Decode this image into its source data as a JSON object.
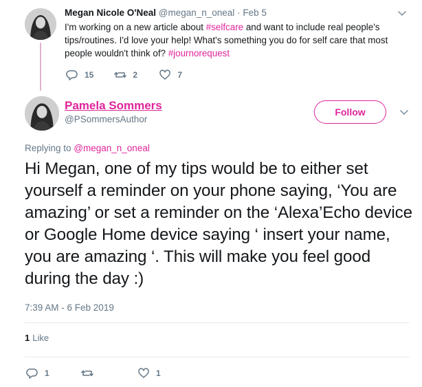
{
  "parent_tweet": {
    "name": "Megan Nicole O'Neal",
    "handle": "@megan_n_oneal",
    "separator": "·",
    "date": "Feb 5",
    "text_1": "I'm working on a new article about ",
    "hashtag_1": "#selfcare",
    "text_2": " and want to include real people's tips/routines. I'd love your help! What's something you do for self care that most people wouldn't think of? ",
    "hashtag_2": "#journorequest",
    "replies": "15",
    "retweets": "2",
    "likes": "7"
  },
  "main_tweet": {
    "name": "Pamela Sommers",
    "handle": "@PSommersAuthor",
    "follow_label": "Follow",
    "replying_label": "Replying to ",
    "replying_handle": "@megan_n_oneal",
    "text": "Hi Megan, one of my tips would be to either set yourself a reminder on your phone saying, ‘You are amazing’ or set a reminder on the ‘Alexa’Echo device or Google Home device saying ‘ insert your name, you are amazing ‘. This will make you feel good during the day :)",
    "timestamp": "7:39 AM - 6 Feb 2019",
    "like_count": "1",
    "like_label": "Like",
    "replies": "1",
    "retweets": "",
    "likes": "1"
  },
  "colors": {
    "accent": "#e0249a",
    "text": "#14171a",
    "muted": "#657786",
    "thread_line": "#e0b3cf",
    "divider": "#e6ecf0"
  },
  "icons": {
    "reply": "reply-icon",
    "retweet": "retweet-icon",
    "like": "heart-icon",
    "menu": "chevron-down-icon"
  }
}
